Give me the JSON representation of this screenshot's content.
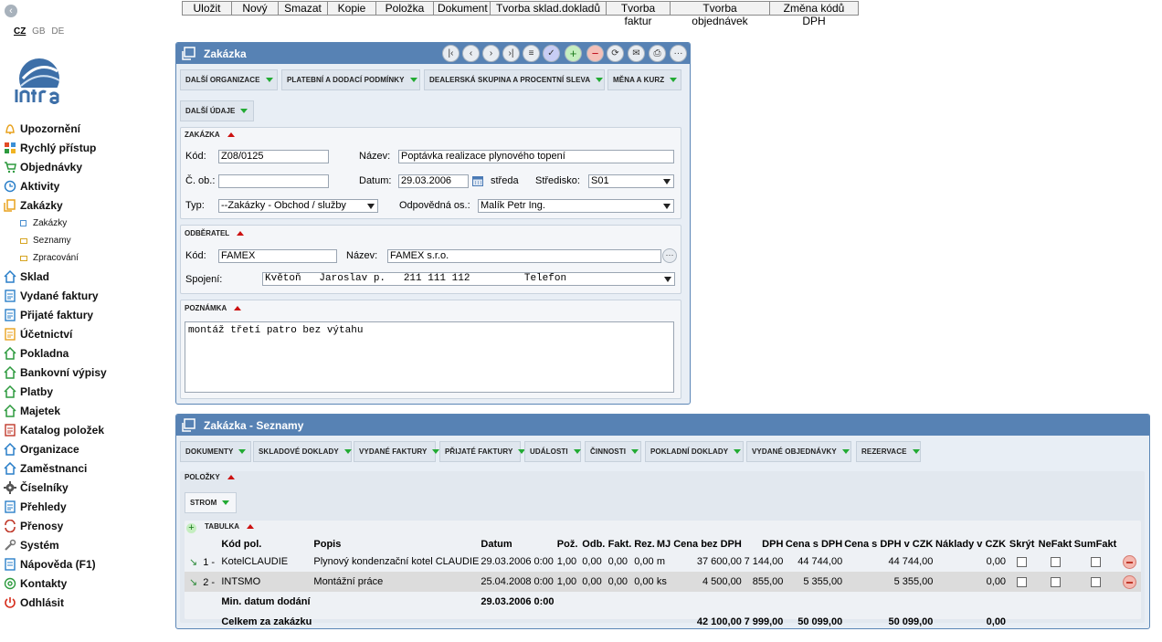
{
  "sidebar": {
    "languages": [
      "CZ",
      "GB",
      "DE"
    ],
    "items": [
      {
        "label": "Upozornění",
        "icon": "bell-icon",
        "color": "#e8a21e"
      },
      {
        "label": "Rychlý přístup",
        "icon": "tiles-icon",
        "color": "#e34c26"
      },
      {
        "label": "Objednávky",
        "icon": "cart-icon",
        "color": "#2d9a3e"
      },
      {
        "label": "Aktivity",
        "icon": "clock-icon",
        "color": "#2a7fc9"
      },
      {
        "label": "Zakázky",
        "icon": "documents-icon",
        "color": "#e8a21e"
      },
      {
        "label": "Sklad",
        "icon": "warehouse-icon",
        "color": "#2a7fc9"
      },
      {
        "label": "Vydané faktury",
        "icon": "invoice-out-icon",
        "color": "#2a7fc9"
      },
      {
        "label": "Přijaté faktury",
        "icon": "invoice-in-icon",
        "color": "#2a7fc9"
      },
      {
        "label": "Účetnictví",
        "icon": "ledger-icon",
        "color": "#e8a21e"
      },
      {
        "label": "Pokladna",
        "icon": "cashbox-icon",
        "color": "#2d9a3e"
      },
      {
        "label": "Bankovní výpisy",
        "icon": "bank-icon",
        "color": "#2d9a3e"
      },
      {
        "label": "Platby",
        "icon": "payment-icon",
        "color": "#2d9a3e"
      },
      {
        "label": "Majetek",
        "icon": "property-icon",
        "color": "#2d9a3e"
      },
      {
        "label": "Katalog položek",
        "icon": "catalog-icon",
        "color": "#c0392b"
      },
      {
        "label": "Organizace",
        "icon": "organization-icon",
        "color": "#2a7fc9"
      },
      {
        "label": "Zaměstnanci",
        "icon": "employees-icon",
        "color": "#2a7fc9"
      },
      {
        "label": "Číselníky",
        "icon": "gear-icon",
        "color": "#555555"
      },
      {
        "label": "Přehledy",
        "icon": "overview-icon",
        "color": "#2a7fc9"
      },
      {
        "label": "Přenosy",
        "icon": "transfer-icon",
        "color": "#c0392b"
      },
      {
        "label": "Systém",
        "icon": "wrench-icon",
        "color": "#777777"
      },
      {
        "label": "Nápověda (F1)",
        "icon": "help-icon",
        "color": "#2a7fc9"
      },
      {
        "label": "Kontakty",
        "icon": "at-icon",
        "color": "#2d9a3e"
      },
      {
        "label": "Odhlásit",
        "icon": "power-icon",
        "color": "#d62c1a"
      }
    ],
    "subitems": [
      "Zakázky",
      "Seznamy",
      "Zpracování"
    ]
  },
  "toolbar": [
    "Uložit",
    "Nový",
    "Smazat",
    "Kopie",
    "Položka",
    "Dokument",
    "Tvorba sklad.dokladů",
    "Tvorba faktur",
    "Tvorba objednávek",
    "Změna kódů DPH"
  ],
  "form": {
    "title": "Zakázka",
    "tabs": [
      "DALŠÍ ORGANIZACE",
      "PLATEBNÍ A DODACÍ PODMÍNKY",
      "DEALERSKÁ SKUPINA A PROCENTNÍ SLEVA",
      "MĚNA A KURZ",
      "DALŠÍ ÚDAJE"
    ],
    "zakazka": {
      "title": "ZAKÁZKA",
      "kod_label": "Kód:",
      "kod": "Z08/0125",
      "nazev_label": "Název:",
      "nazev": "Poptávka realizace plynového topení",
      "cob_label": "Č. ob.:",
      "cob": "",
      "datum_label": "Datum:",
      "datum": "29.03.2006",
      "den": "středa",
      "stredisko_label": "Středisko:",
      "stredisko": "S01",
      "typ_label": "Typ:",
      "typ": "--Zakázky - Obchod / služby",
      "odp_label": "Odpovědná os.:",
      "odp": "Malík Petr Ing."
    },
    "odberatel": {
      "title": "ODBĚRATEL",
      "kod_label": "Kód:",
      "kod": "FAMEX",
      "nazev_label": "Název:",
      "nazev": "FAMEX s.r.o.",
      "spojeni_label": "Spojení:",
      "spojeni": "Květoň   Jaroslav p.   211 111 112         Telefon"
    },
    "poznamka": {
      "title": "POZNÁMKA",
      "text": "montáž třetí patro bez výtahu"
    }
  },
  "lists": {
    "title": "Zakázka - Seznamy",
    "tabs": [
      "DOKUMENTY",
      "SKLADOVÉ DOKLADY",
      "VYDANÉ FAKTURY",
      "PŘIJATÉ FAKTURY",
      "UDÁLOSTI",
      "ČINNOSTI",
      "POKLADNÍ DOKLADY",
      "VYDANÉ OBJEDNÁVKY",
      "REZERVACE"
    ],
    "polozky_label": "POLOŽKY",
    "strom_label": "STROM",
    "tabulka_label": "TABULKA",
    "columns": [
      "Kód pol.",
      "Popis",
      "Datum",
      "Pož.",
      "Odb.",
      "Fakt.",
      "Rez.",
      "MJ",
      "Cena bez DPH",
      "DPH",
      "Cena s DPH",
      "Cena s DPH v CZK",
      "Náklady v CZK",
      "Skrýt",
      "NeFakt",
      "SumFakt"
    ],
    "rows": [
      {
        "no": "1 -",
        "kod": "KotelCLAUDIE",
        "popis": "Plynový kondenzační kotel CLAUDIE",
        "datum": "29.03.2006 0:00",
        "poz": "1,00",
        "odb": "0,00",
        "fakt": "0,00",
        "rez": "0,00",
        "mj": "m",
        "cena_bez": "37 600,00",
        "dph": "7 144,00",
        "cena_s": "44 744,00",
        "cena_czk": "44 744,00",
        "naklady": "0,00"
      },
      {
        "no": "2 -",
        "kod": "INTSMO",
        "popis": "Montážní práce",
        "datum": "25.04.2008 0:00",
        "poz": "1,00",
        "odb": "0,00",
        "fakt": "0,00",
        "rez": "0,00",
        "mj": "ks",
        "cena_bez": "4 500,00",
        "dph": "855,00",
        "cena_s": "5 355,00",
        "cena_czk": "5 355,00",
        "naklady": "0,00"
      }
    ],
    "summary": {
      "min_label": "Min. datum dodání",
      "min_value": "29.03.2006 0:00",
      "total_label": "Celkem za zakázku",
      "total_cena_bez": "42 100,00",
      "total_dph": "7 999,00",
      "total_cena_s": "50 099,00",
      "total_czk": "50 099,00",
      "total_naklady": "0,00"
    }
  },
  "colors": {
    "panel_header": "#5782b4",
    "panel_bg": "#e8eef5",
    "accent_green": "#22aa33",
    "accent_red": "#cc1111"
  }
}
